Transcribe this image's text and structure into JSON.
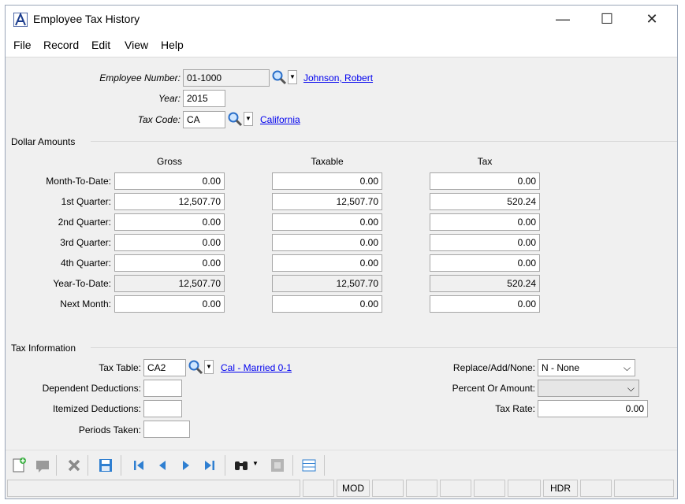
{
  "window": {
    "title": "Employee Tax History"
  },
  "menu": [
    "File",
    "Record",
    "Edit",
    "View",
    "Help"
  ],
  "header": {
    "employee_number_label": "Employee Number:",
    "employee_number": "01-1000",
    "employee_name": "Johnson, Robert",
    "year_label": "Year:",
    "year": "2015",
    "tax_code_label": "Tax Code:",
    "tax_code": "CA",
    "tax_code_name": "California"
  },
  "dollar_amounts": {
    "section_label": "Dollar Amounts",
    "columns": [
      "Gross",
      "Taxable",
      "Tax"
    ],
    "rows": [
      {
        "label": "Month-To-Date:",
        "gross": "0.00",
        "taxable": "0.00",
        "tax": "0.00"
      },
      {
        "label": "1st Quarter:",
        "gross": "12,507.70",
        "taxable": "12,507.70",
        "tax": "520.24"
      },
      {
        "label": "2nd Quarter:",
        "gross": "0.00",
        "taxable": "0.00",
        "tax": "0.00"
      },
      {
        "label": "3rd Quarter:",
        "gross": "0.00",
        "taxable": "0.00",
        "tax": "0.00"
      },
      {
        "label": "4th Quarter:",
        "gross": "0.00",
        "taxable": "0.00",
        "tax": "0.00"
      },
      {
        "label": "Year-To-Date:",
        "gross": "12,507.70",
        "taxable": "12,507.70",
        "tax": "520.24"
      },
      {
        "label": "Next Month:",
        "gross": "0.00",
        "taxable": "0.00",
        "tax": "0.00"
      }
    ]
  },
  "tax_information": {
    "section_label": "Tax Information",
    "tax_table_label": "Tax Table:",
    "tax_table": "CA2",
    "tax_table_name": "Cal - Married 0-1",
    "dependent_deductions_label": "Dependent Deductions:",
    "dependent_deductions": "",
    "itemized_deductions_label": "Itemized Deductions:",
    "itemized_deductions": "",
    "periods_taken_label": "Periods Taken:",
    "periods_taken": "",
    "replace_add_none_label": "Replace/Add/None:",
    "replace_add_none": "N - None",
    "percent_or_amount_label": "Percent Or Amount:",
    "percent_or_amount": "",
    "tax_rate_label": "Tax Rate:",
    "tax_rate": "0.00"
  },
  "status": {
    "mode": "MOD",
    "hdr": "HDR"
  },
  "colors": {
    "accent": "#1a3b8c",
    "link": "#0000ee",
    "window_bg": "#f0f0f0"
  }
}
